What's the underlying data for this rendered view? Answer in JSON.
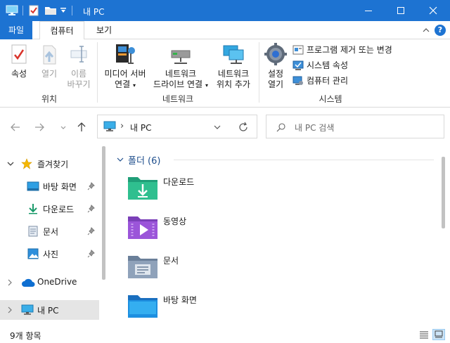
{
  "title": "내 PC",
  "quick_access": {
    "computer_icon": "computer-icon",
    "properties_icon": "properties-check-icon",
    "new_folder_icon": "folder-icon",
    "customize_icon": "chevron-down-icon"
  },
  "window_buttons": [
    "minimize-icon",
    "maximize-icon",
    "close-icon"
  ],
  "tabs": {
    "file": "파일",
    "items": [
      {
        "label": "컴퓨터",
        "active": true
      },
      {
        "label": "보기",
        "active": false
      }
    ]
  },
  "ribbon": {
    "location": {
      "label": "위치",
      "properties": "속성",
      "open": "열기",
      "rename_line1": "이름",
      "rename_line2": "바꾸기"
    },
    "network": {
      "label": "네트워크",
      "media_line1": "미디어 서버",
      "media_line2": "연결",
      "map_drive_line1": "네트워크",
      "map_drive_line2": "드라이브 연결",
      "add_location_line1": "네트워크",
      "add_location_line2": "위치 추가"
    },
    "system": {
      "label": "시스템",
      "settings_line1": "설정",
      "settings_line2": "열기",
      "uninstall": "프로그램 제거 또는 변경",
      "system_properties": "시스템 속성",
      "manage": "컴퓨터 관리"
    }
  },
  "address": {
    "path": "내 PC",
    "separator": "›"
  },
  "search": {
    "placeholder": "내 PC 검색"
  },
  "navigation": {
    "quick_access": "즐겨찾기",
    "pinned": [
      {
        "label": "바탕 화면",
        "icon": "desktop-icon"
      },
      {
        "label": "다운로드",
        "icon": "download-icon"
      },
      {
        "label": "문서",
        "icon": "document-icon"
      },
      {
        "label": "사진",
        "icon": "pictures-icon"
      }
    ],
    "onedrive": "OneDrive",
    "this_pc": "내 PC"
  },
  "content": {
    "group_title": "폴더 (6)",
    "folders": [
      {
        "label": "다운로드",
        "icon": "downloads-folder-icon"
      },
      {
        "label": "동영상",
        "icon": "videos-folder-icon"
      },
      {
        "label": "문서",
        "icon": "documents-folder-icon"
      },
      {
        "label": "바탕 화면",
        "icon": "desktop-folder-icon"
      }
    ]
  },
  "status": {
    "item_count": "9개 항목"
  },
  "colors": {
    "accent": "#1d73d2",
    "selection": "#cce4f7",
    "group_header": "#1e4e8c"
  }
}
